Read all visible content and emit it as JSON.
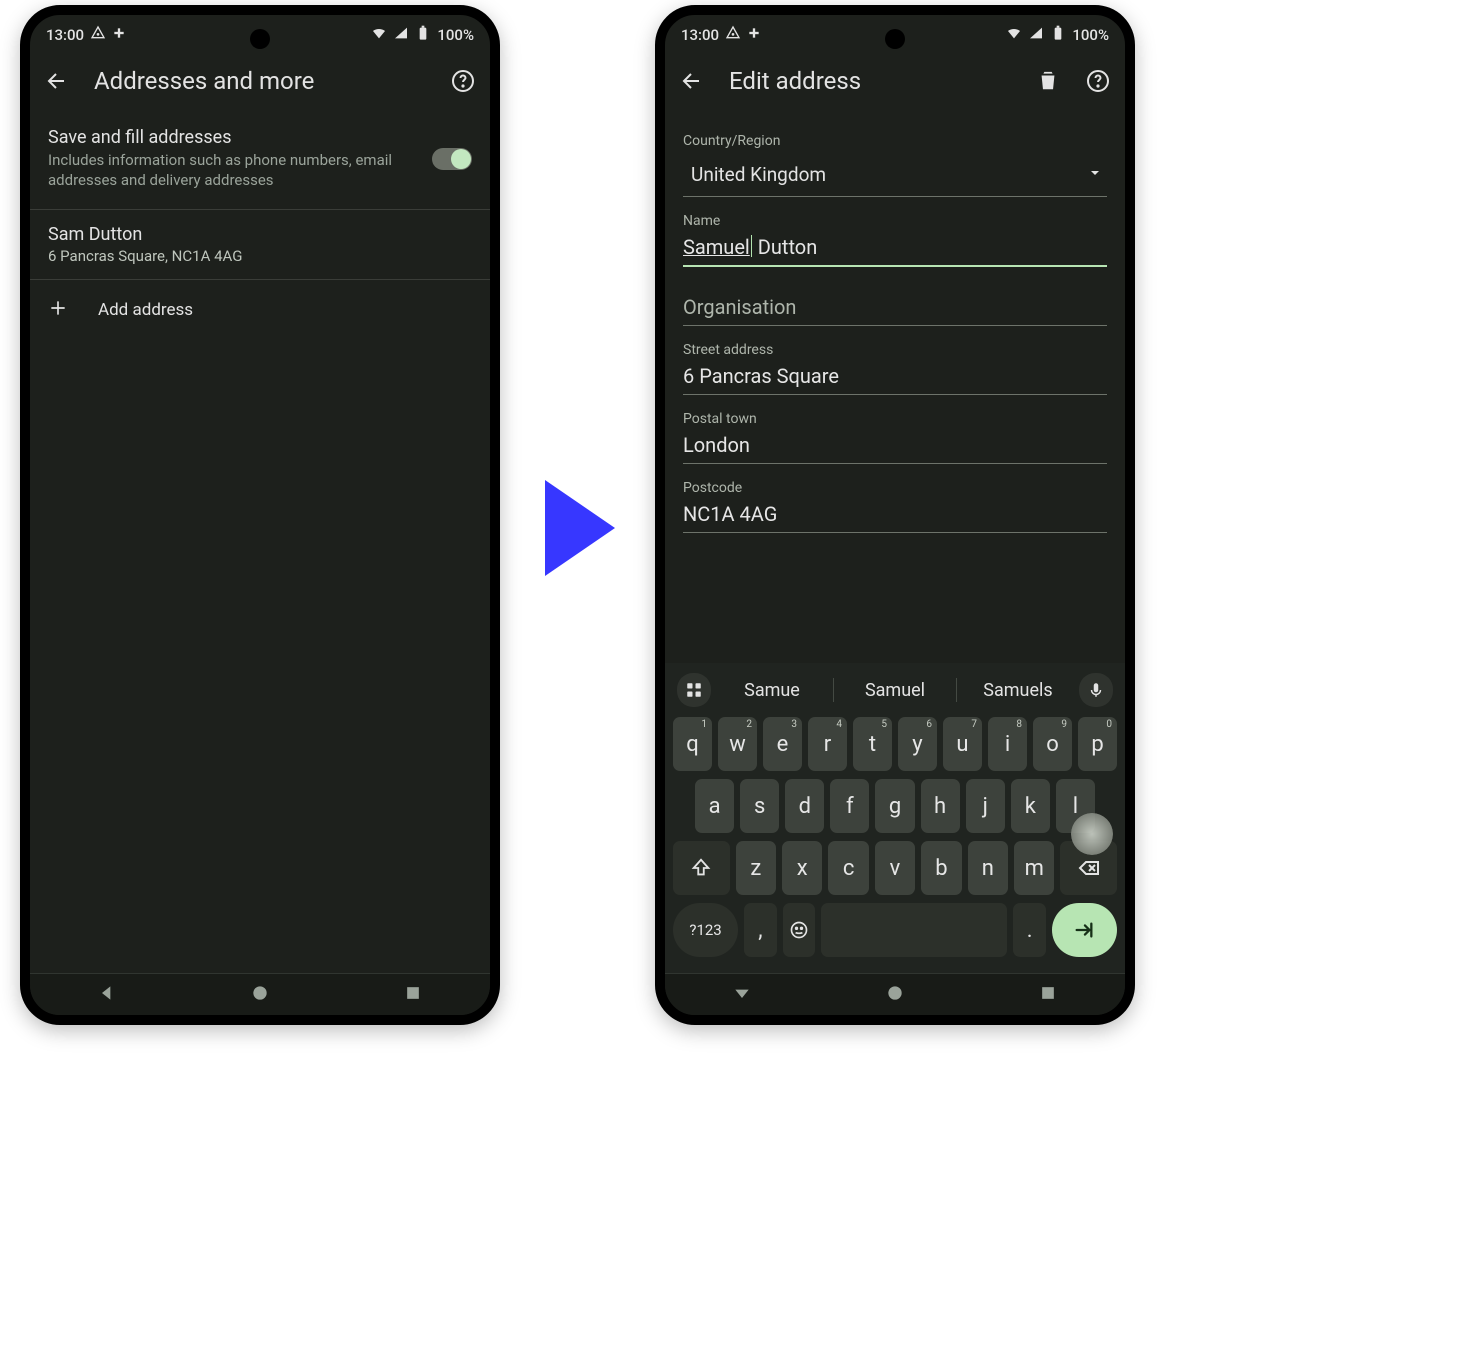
{
  "status": {
    "time": "13:00",
    "battery": "100%"
  },
  "left": {
    "title": "Addresses and more",
    "toggle": {
      "title": "Save and fill addresses",
      "desc": "Includes information such as phone numbers, email addresses and delivery addresses"
    },
    "address": {
      "name": "Sam Dutton",
      "line": "6 Pancras Square, NC1A 4AG"
    },
    "add": "Add address"
  },
  "right": {
    "title": "Edit address",
    "labels": {
      "country": "Country/Region",
      "name": "Name",
      "org": "Organisation",
      "street": "Street address",
      "town": "Postal town",
      "postcode": "Postcode"
    },
    "values": {
      "country": "United Kingdom",
      "name_first": "Samuel",
      "name_rest": " Dutton",
      "org": "Organisation",
      "street": "6 Pancras Square",
      "town": "London",
      "postcode": "NC1A 4AG"
    }
  },
  "keyboard": {
    "suggestions": [
      "Samue",
      "Samuel",
      "Samuels"
    ],
    "row1": [
      "q",
      "w",
      "e",
      "r",
      "t",
      "y",
      "u",
      "i",
      "o",
      "p"
    ],
    "row1sup": [
      "1",
      "2",
      "3",
      "4",
      "5",
      "6",
      "7",
      "8",
      "9",
      "0"
    ],
    "row2": [
      "a",
      "s",
      "d",
      "f",
      "g",
      "h",
      "j",
      "k",
      "l"
    ],
    "row3": [
      "z",
      "x",
      "c",
      "v",
      "b",
      "n",
      "m"
    ],
    "numkey": "?123",
    "comma": ",",
    "period": "."
  }
}
